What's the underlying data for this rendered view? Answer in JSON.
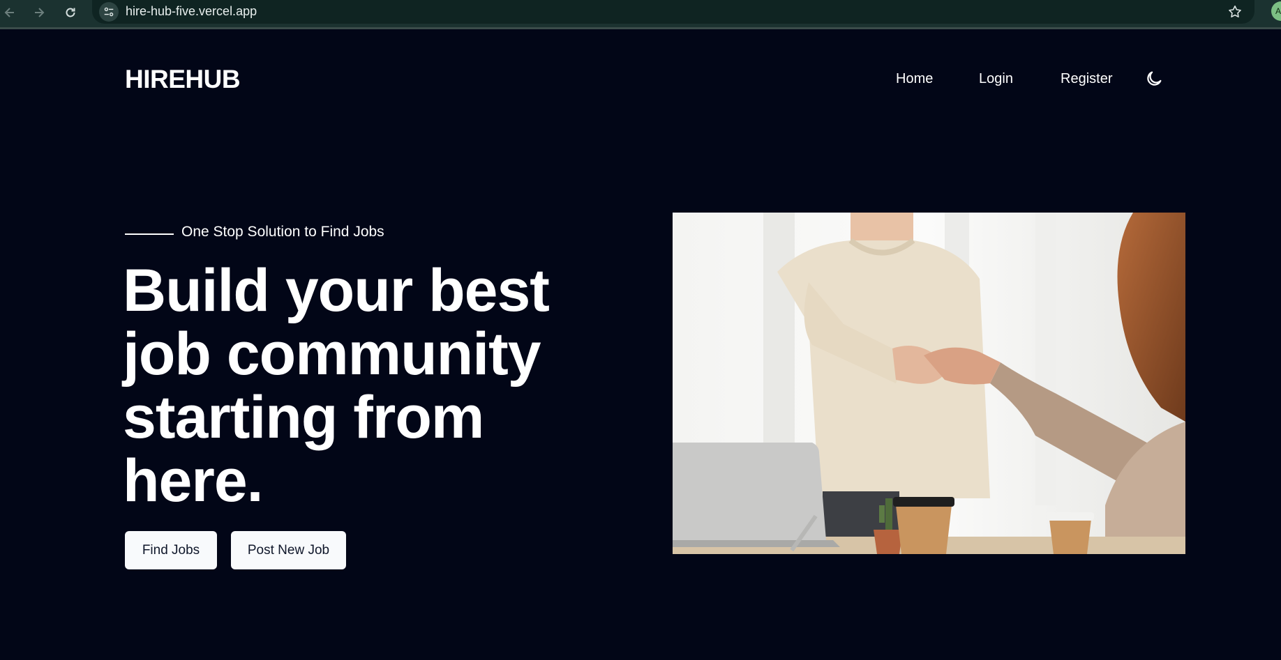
{
  "browser": {
    "url": "hire-hub-five.vercel.app",
    "profile_initial": "A",
    "icons": {
      "back": "arrow-left-icon",
      "forward": "arrow-right-icon",
      "reload": "reload-icon",
      "site_info": "tune-icon",
      "bookmark": "star-icon"
    }
  },
  "header": {
    "logo": "HIREHUB",
    "nav": {
      "home": "Home",
      "login": "Login",
      "register": "Register"
    },
    "theme_icon": "moon-icon"
  },
  "hero": {
    "tagline": "One Stop Solution to Find Jobs",
    "title": "Build your best job community starting from here.",
    "buttons": {
      "find_jobs": "Find Jobs",
      "post_job": "Post New Job"
    },
    "image_subject": "handshake-photo"
  },
  "colors": {
    "page_background": "#020617",
    "browser_bar": "#1b3230",
    "text": "#ffffff",
    "button_background": "#f8fafc",
    "button_text": "#0f172a"
  }
}
